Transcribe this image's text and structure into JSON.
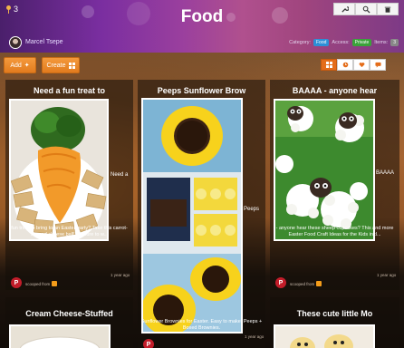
{
  "header": {
    "title": "Food",
    "pin_count": "3",
    "author": "Marcel Tsepe",
    "category_label": "Category:",
    "category_value": "Food",
    "access_label": "Access:",
    "access_value": "Private",
    "items_label": "Items:",
    "items_value": "3",
    "tools": [
      "wrench-icon",
      "magnify-icon",
      "trash-icon"
    ]
  },
  "toolbar": {
    "add_label": "Add",
    "create_label": "Create",
    "view_icons": [
      "grid-icon",
      "clock-icon",
      "heart-icon",
      "comment-icon"
    ]
  },
  "cards": [
    {
      "title": "Need a fun treat to",
      "side_text": "Need a",
      "desc": "fun treat to bring to an Easter party? Take this carrot-shaped cheese ball! It's sure to w...",
      "time": "1 year ago",
      "scooped": "scooped from"
    },
    {
      "title": "Peeps Sunflower Brow",
      "side_text": "Peeps",
      "desc": "Sunflower Brownies for Easter. Easy to make! Peeps + Boxed Brownies.",
      "time": "1 year ago",
      "scooped": ""
    },
    {
      "title": "BAAAA - anyone hear",
      "side_text": "BAAAA",
      "desc": "- anyone hear these sheep cupcakes? This and more Easter Food Craft Ideas for the Kids incl...",
      "time": "1 year ago",
      "scooped": "scooped from"
    },
    {
      "title": "Cream Cheese-Stuffed",
      "side_text": "",
      "desc": "",
      "time": "",
      "scooped": ""
    },
    {
      "title": "These cute little Mo",
      "side_text": "",
      "desc": "",
      "time": "",
      "scooped": ""
    }
  ],
  "colors": {
    "header_accent": "#9a3f9e",
    "button_orange": "#e88626",
    "pin_red": "#c21d2a",
    "category_blue": "#2c8fd6",
    "access_green": "#3aa33a"
  }
}
